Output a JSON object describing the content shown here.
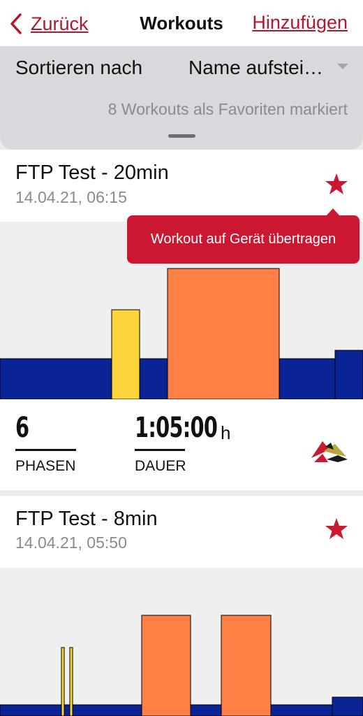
{
  "nav": {
    "back_label": "Zurück",
    "title": "Workouts",
    "add_label": "Hinzufügen"
  },
  "sort": {
    "label": "Sortieren nach",
    "value": "Name aufstei…",
    "favorites_info": "8 Workouts als Favoriten markiert"
  },
  "tooltip": "Workout auf Gerät übertragen",
  "workouts": [
    {
      "title": "FTP Test - 20min",
      "date": "14.04.21, 06:15",
      "favorite": true,
      "phases_value": "6",
      "phases_label": "PHASEN",
      "duration_value": "1:05:00",
      "duration_unit": "h",
      "duration_label": "DAUER"
    },
    {
      "title": "FTP Test - 8min",
      "date": "14.04.21, 05:50",
      "favorite": true
    }
  ],
  "colors": {
    "accent": "#b5162d",
    "star": "#cc1733",
    "zone_blue": "#0a2496",
    "zone_yellow": "#fcd53a",
    "zone_orange": "#ff7f45"
  },
  "icons": [
    "chevron-left-icon",
    "star-icon",
    "chevron-down-icon",
    "brand-logo-icon"
  ]
}
